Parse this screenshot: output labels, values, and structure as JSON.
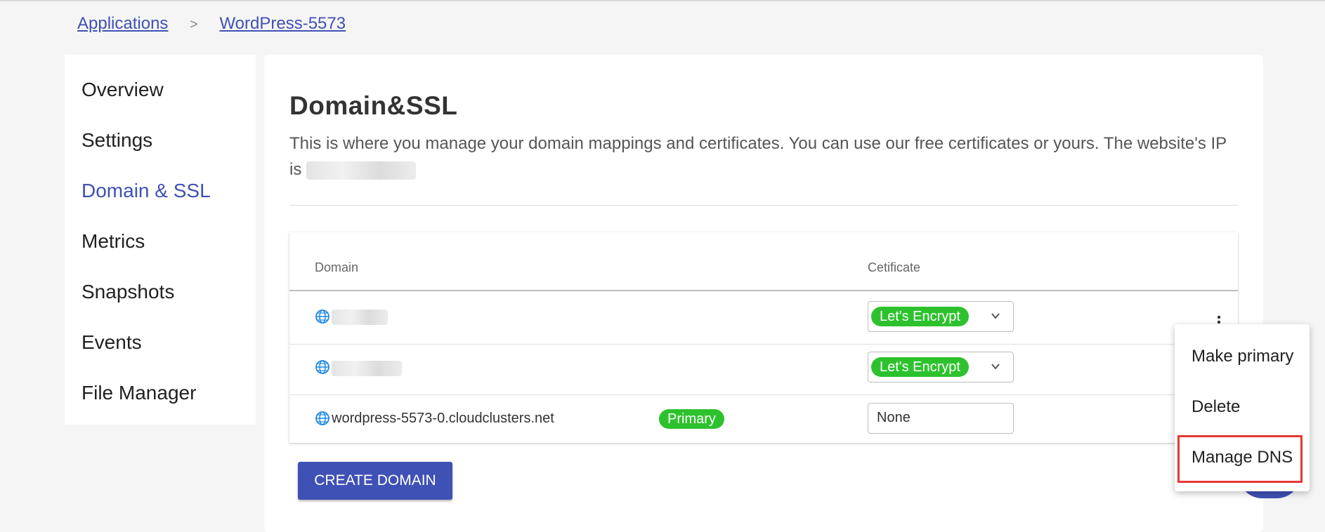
{
  "breadcrumb": {
    "items": [
      "Applications",
      "WordPress-5573"
    ],
    "separator": ">"
  },
  "sidebar": {
    "items": [
      {
        "label": "Overview"
      },
      {
        "label": "Settings"
      },
      {
        "label": "Domain & SSL",
        "active": true
      },
      {
        "label": "Metrics"
      },
      {
        "label": "Snapshots"
      },
      {
        "label": "Events"
      },
      {
        "label": "File Manager"
      }
    ]
  },
  "page": {
    "title": "Domain&SSL",
    "description_line1": "This is where you manage your domain mappings and certificates. You can use our free certificates or yours. The website's IP",
    "description_line2": "is"
  },
  "table": {
    "headers": {
      "domain": "Domain",
      "certificate": "Cetificate"
    },
    "rows": [
      {
        "domain": "",
        "certificate": "Let's Encrypt",
        "icon": "globe-icon"
      },
      {
        "domain": "",
        "certificate": "Let's Encrypt",
        "icon": "globe-icon"
      },
      {
        "domain": "wordpress-5573-0.cloudclusters.net",
        "badge": "Primary",
        "certificate": "None",
        "icon": "globe-icon"
      }
    ]
  },
  "buttons": {
    "create_domain": "CREATE DOMAIN"
  },
  "context_menu": {
    "items": [
      "Make primary",
      "Delete",
      "Manage DNS"
    ],
    "highlighted": "Manage DNS"
  },
  "colors": {
    "accent": "#3f51b5",
    "chip_green": "#2dc22d",
    "highlight_red": "#e53935"
  }
}
